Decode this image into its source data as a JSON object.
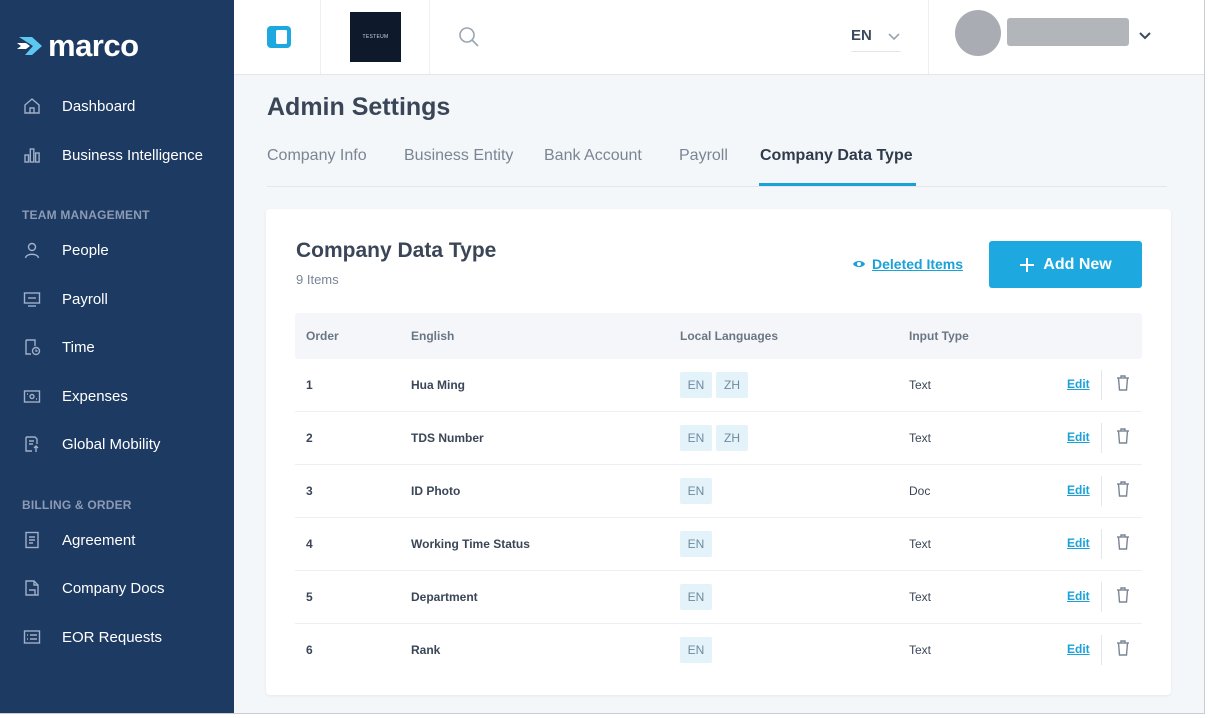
{
  "brand": {
    "name": "marco"
  },
  "sidebar": {
    "items_top": [
      {
        "label": "Dashboard",
        "icon": "home-icon"
      },
      {
        "label": "Business Intelligence",
        "icon": "bar-chart-icon"
      }
    ],
    "sections": [
      {
        "title": "TEAM MANAGEMENT",
        "items": [
          {
            "label": "People",
            "icon": "user-icon"
          },
          {
            "label": "Payroll",
            "icon": "payroll-icon"
          },
          {
            "label": "Time",
            "icon": "time-icon"
          },
          {
            "label": "Expenses",
            "icon": "expenses-icon"
          },
          {
            "label": "Global Mobility",
            "icon": "global-mobility-icon"
          }
        ]
      },
      {
        "title": "BILLING & ORDER",
        "items": [
          {
            "label": "Agreement",
            "icon": "agreement-icon"
          },
          {
            "label": "Company Docs",
            "icon": "company-docs-icon"
          },
          {
            "label": "EOR Requests",
            "icon": "eor-requests-icon"
          }
        ]
      }
    ]
  },
  "topbar": {
    "company_logo_text": "TESTEUM",
    "language": "EN"
  },
  "page": {
    "title": "Admin Settings",
    "tabs": [
      "Company Info",
      "Business Entity",
      "Bank Account",
      "Payroll",
      "Company Data Type"
    ],
    "active_tab": "Company Data Type"
  },
  "card": {
    "title": "Company Data Type",
    "count": "9 Items",
    "deleted_items_label": "Deleted Items",
    "add_new_label": "Add New",
    "columns": [
      "Order",
      "English",
      "Local Languages",
      "Input Type"
    ],
    "edit_label": "Edit",
    "rows": [
      {
        "order": "1",
        "english": "Hua Ming",
        "langs": [
          "EN",
          "ZH"
        ],
        "input_type": "Text"
      },
      {
        "order": "2",
        "english": "TDS Number",
        "langs": [
          "EN",
          "ZH"
        ],
        "input_type": "Text"
      },
      {
        "order": "3",
        "english": "ID Photo",
        "langs": [
          "EN"
        ],
        "input_type": "Doc"
      },
      {
        "order": "4",
        "english": "Working Time Status",
        "langs": [
          "EN"
        ],
        "input_type": "Text"
      },
      {
        "order": "5",
        "english": "Department",
        "langs": [
          "EN"
        ],
        "input_type": "Text"
      },
      {
        "order": "6",
        "english": "Rank",
        "langs": [
          "EN"
        ],
        "input_type": "Text"
      }
    ]
  },
  "colors": {
    "sidebar_bg": "#1d3a63",
    "accent": "#1aa2d8",
    "button": "#1ea8e0"
  }
}
